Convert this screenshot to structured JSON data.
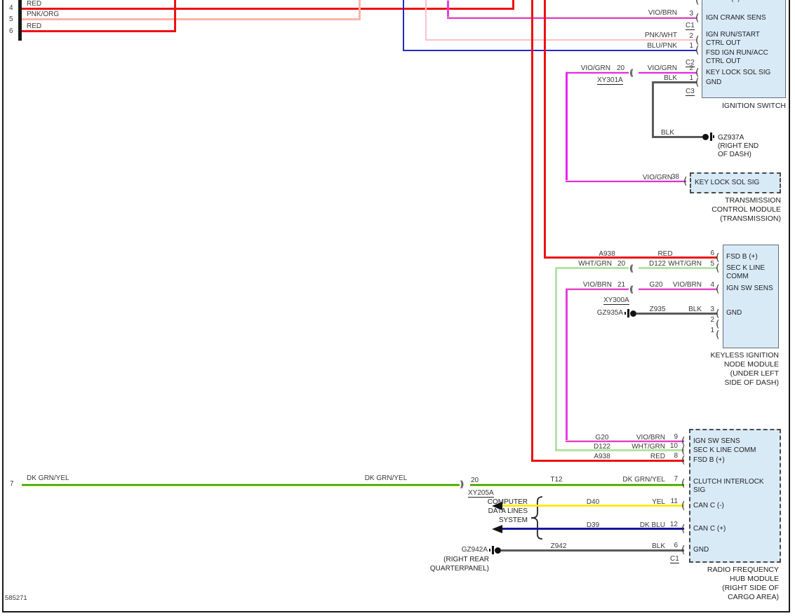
{
  "page": {
    "diagram_id": "585271"
  },
  "glyphs": {
    "pin_bracket": "(",
    "splice_open": "((",
    "splice_close": "))"
  },
  "colors": {
    "red": "#ee1111",
    "pnk_org": "#ffb4a6",
    "pnk_wht": "#ffc0cb",
    "blu_pnk": "#2727cf",
    "vio_brn": "#e63ce0",
    "vio_grn": "#ee22ee",
    "wht_grn": "#b7e2a3",
    "blk": "#5a5a5a",
    "dk_grn_yel": "#1f9e1f",
    "yel": "#ffe913",
    "dk_blu": "#16169e",
    "module_fill": "#d9eaf7"
  },
  "left_rows": {
    "row4": {
      "num": "4",
      "label": "RED"
    },
    "row5": {
      "num": "5",
      "label": "PNK/ORG"
    },
    "row6": {
      "num": "6",
      "label": "RED"
    },
    "row7": {
      "num": "7",
      "label": "DK GRN/YEL",
      "mid_label": "DK GRN/YEL"
    }
  },
  "ign": {
    "title": "IGNITION SWITCH",
    "partial": "(+)",
    "c1": "C1",
    "c2": "C2",
    "c3": "C3",
    "row_crank": {
      "wire": "VIO/BRN",
      "pin": "3",
      "signal": "IGN CRANK SENS"
    },
    "row_run": {
      "wire": "PNK/WHT",
      "pin": "2",
      "signal": "IGN RUN/START\nCTRL OUT"
    },
    "row_fsd": {
      "wire": "BLU/PNK",
      "pin": "1",
      "signal": "FSD IGN RUN/ACC\nCTRL OUT"
    },
    "row_key": {
      "wire_left": "VIO/GRN",
      "gauge": "20",
      "splice": "XY301A",
      "wire": "VIO/GRN",
      "pin": "2",
      "signal": "KEY LOCK SOL SIG"
    },
    "row_gnd": {
      "wire": "BLK",
      "pin": "1",
      "signal": "GND"
    }
  },
  "gz937a": {
    "wire": "BLK",
    "name": "GZ937A",
    "loc": "(RIGHT END\nOF DASH)"
  },
  "tcm": {
    "wire": "VIO/GRN",
    "pin": "38",
    "signal": "KEY LOCK SOL SIG",
    "name": "TRANSMISSION\nCONTROL MODULE\n(TRANSMISSION)"
  },
  "kin": {
    "name": "KEYLESS IGNITION\nNODE MODULE\n(UNDER LEFT\nSIDE OF DASH)",
    "row_fsd": {
      "circuit": "A938",
      "wire": "RED",
      "pin": "6",
      "signal": "FSD B (+)"
    },
    "row_sec": {
      "wire_left": "WHT/GRN",
      "gauge": "20",
      "circuit": "D122",
      "wire": "WHT/GRN",
      "pin": "5",
      "signal": "SEC K LINE\nCOMM"
    },
    "row_ign": {
      "wire_left": "VIO/BRN",
      "gauge": "21",
      "splice": "XY300A",
      "circuit": "G20",
      "wire": "VIO/BRN",
      "pin": "4",
      "signal": "IGN SW SENS"
    },
    "row_gnd": {
      "ground": "GZ935A",
      "circuit": "Z935",
      "wire": "BLK",
      "pin": "3",
      "signal": "GND"
    },
    "pin2": "2",
    "pin1": "1"
  },
  "rfh": {
    "name": "RADIO FREQUENCY\nHUB MODULE\n(RIGHT SIDE OF\nCARGO AREA)",
    "row_ign": {
      "circuit": "G20",
      "wire": "VIO/BRN",
      "pin": "9",
      "signal": "IGN SW SENS"
    },
    "row_sec": {
      "circuit": "D122",
      "wire": "WHT/GRN",
      "pin": "10",
      "signal": "SEC K LINE COMM"
    },
    "row_fsd": {
      "circuit": "A938",
      "wire": "RED",
      "pin": "8",
      "signal": "FSD B (+)"
    },
    "row_clutch": {
      "circuit": "T12",
      "wire": "DK GRN/YEL",
      "pin": "7",
      "signal": "CLUTCH INTERLOCK\nSIG",
      "gauge": "20",
      "splice": "XY205A"
    },
    "row_canm": {
      "circuit": "D40",
      "wire": "YEL",
      "pin": "11",
      "signal": "CAN C (-)"
    },
    "row_canp": {
      "circuit": "D39",
      "wire": "DK BLU",
      "pin": "12",
      "signal": "CAN C (+)"
    },
    "row_gnd": {
      "circuit": "Z942",
      "wire": "BLK",
      "pin": "6",
      "signal": "GND",
      "connector": "C1"
    }
  },
  "gz942a": {
    "name": "GZ942A",
    "loc": "(RIGHT REAR\nQUARTERPANEL)"
  },
  "cdl": {
    "label": "COMPUTER\nDATA LINES\nSYSTEM"
  }
}
